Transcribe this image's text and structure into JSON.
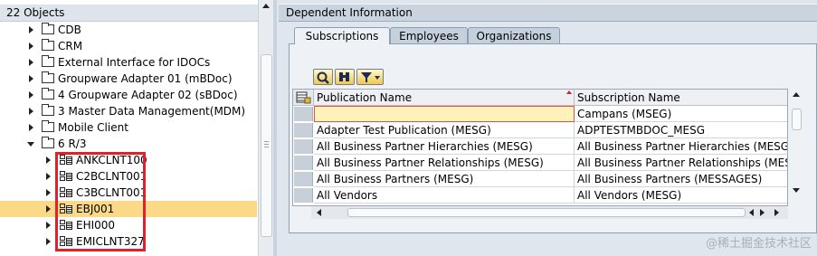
{
  "left_pane": {
    "header": "22 Objects",
    "items": [
      {
        "label": "CDB",
        "type": "folder",
        "level": 1
      },
      {
        "label": "CRM",
        "type": "folder",
        "level": 1
      },
      {
        "label": "External Interface for IDOCs",
        "type": "folder",
        "level": 1
      },
      {
        "label": "Groupware Adapter 01 (mBDoc)",
        "type": "folder",
        "level": 1
      },
      {
        "label": "4 Groupware Adapter 02 (sBDoc)",
        "type": "folder",
        "level": 1
      },
      {
        "label": "3 Master Data Management(MDM)",
        "type": "folder",
        "level": 1
      },
      {
        "label": "Mobile Client",
        "type": "folder",
        "level": 1
      },
      {
        "label": "6 R/3",
        "type": "folder-open",
        "level": 1
      },
      {
        "label": "ANKCLNT100",
        "type": "system",
        "level": 2
      },
      {
        "label": "C2BCLNT001",
        "type": "system",
        "level": 2
      },
      {
        "label": "C3BCLNT001",
        "type": "system",
        "level": 2
      },
      {
        "label": "EBJ001",
        "type": "system",
        "level": 2,
        "selected": true
      },
      {
        "label": "EHI000",
        "type": "system",
        "level": 2
      },
      {
        "label": "EMICLNT327",
        "type": "system",
        "level": 2
      }
    ]
  },
  "right_pane": {
    "title": "Dependent Information",
    "tabs": [
      {
        "label": "Subscriptions",
        "active": true
      },
      {
        "label": "Employees",
        "active": false
      },
      {
        "label": "Organizations",
        "active": false
      }
    ],
    "toolbar": [
      {
        "icon": "details-icon"
      },
      {
        "icon": "find-icon"
      },
      {
        "icon": "filter-icon"
      }
    ],
    "grid": {
      "columns": [
        "Publication Name",
        "Subscription Name"
      ],
      "rows": [
        [
          "",
          "Campans (MSEG)"
        ],
        [
          "Adapter Test Publication (MESG)",
          "ADPTESTMBDOC_MESG"
        ],
        [
          "All Business Partner Hierarchies (MESG)",
          "All Business Partner Hierarchies (MESG)"
        ],
        [
          "All Business Partner Relationships (MESG)",
          "All Business Partner Relationships (MESSAG"
        ],
        [
          "All Business Partners (MESG)",
          "All Business Partners (MESSAGES)"
        ],
        [
          "All Vendors",
          "All Vendors (MESG)"
        ]
      ]
    }
  },
  "watermark": "@稀土掘金技术社区",
  "colors": {
    "selected_row": "#fbd987",
    "highlight_box": "#e0202a",
    "panel_bg": "#dfe6ee"
  }
}
